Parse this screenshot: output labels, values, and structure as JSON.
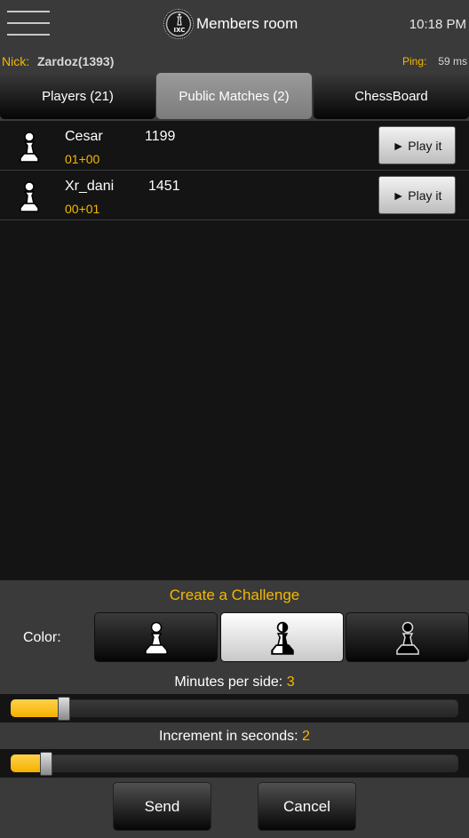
{
  "header": {
    "menu_icon": "hamburger-icon",
    "logo_text": "IXC",
    "title": "Members room",
    "clock": "10:18 PM"
  },
  "status": {
    "nick_label": "Nick:",
    "nick_value": "Zardoz(1393)",
    "ping_label": "Ping:",
    "ping_value": "59 ms"
  },
  "tabs": [
    {
      "label": "Players (21)",
      "active": false
    },
    {
      "label": "Public Matches (2)",
      "active": true
    },
    {
      "label": "ChessBoard",
      "active": false
    }
  ],
  "matches": [
    {
      "icon": "pawn-icon",
      "name": "Cesar",
      "rating": "1199",
      "time": "01+00",
      "action": "► Play it"
    },
    {
      "icon": "pawn-icon",
      "name": "Xr_dani",
      "rating": "1451",
      "time": "00+01",
      "action": "► Play it"
    }
  ],
  "challenge": {
    "title": "Create a Challenge",
    "color_label": "Color:",
    "color_options": [
      {
        "name": "white-pawn-icon",
        "selected": false
      },
      {
        "name": "random-pawn-icon",
        "selected": true
      },
      {
        "name": "black-pawn-icon",
        "selected": false
      }
    ],
    "minutes_label": "Minutes per side:",
    "minutes_value": "3",
    "minutes_fraction": 0.12,
    "increment_label": "Increment in seconds:",
    "increment_value": "2",
    "increment_fraction": 0.08,
    "send_label": "Send",
    "cancel_label": "Cancel"
  },
  "colors": {
    "accent": "#f5b800",
    "background": "#141414",
    "panel": "#3a3a3a"
  }
}
